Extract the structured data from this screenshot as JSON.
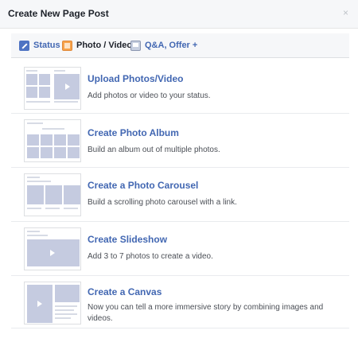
{
  "dialog": {
    "title": "Create New Page Post",
    "close_icon": "×"
  },
  "tabs": [
    {
      "label": "Status",
      "icon": "pencil-icon"
    },
    {
      "label": "Photo / Video",
      "icon": "photo-icon",
      "active": true
    },
    {
      "label": "Q&A, Offer +",
      "icon": "qa-icon"
    }
  ],
  "options": [
    {
      "title": "Upload Photos/Video",
      "description": "Add photos or video to your status."
    },
    {
      "title": "Create Photo Album",
      "description": "Build an album out of multiple photos."
    },
    {
      "title": "Create a Photo Carousel",
      "description": "Build a scrolling photo carousel with a link."
    },
    {
      "title": "Create Slideshow",
      "description": "Add 3 to 7 photos to create a video."
    },
    {
      "title": "Create a Canvas",
      "description": "Now you can tell a more immersive story by combining images and videos."
    }
  ],
  "colors": {
    "link": "#4267b2",
    "header_bg": "#f6f7f9",
    "thumb_block": "#c5cbe0"
  }
}
